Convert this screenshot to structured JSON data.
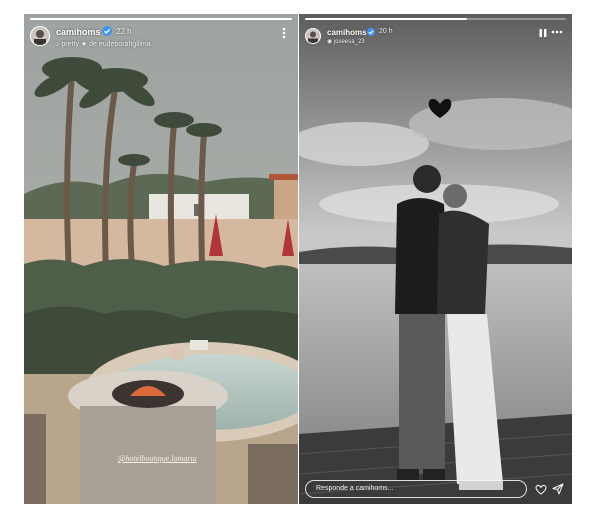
{
  "left_story": {
    "username": "camihoms",
    "time": "22 h",
    "subline": "pretty ★ de eudeborahgllima",
    "mention": "@hotelboutique.lamaria",
    "progress": 1.0,
    "icons": {
      "avatar": "avatar-image",
      "verified": "verified-badge",
      "music": "music-note-icon",
      "more": "more-icon"
    }
  },
  "right_story": {
    "username": "camihoms",
    "time": "20 h",
    "subline": "joseesa_23",
    "reply_placeholder": "Responde a camihoms...",
    "progress": 0.62,
    "icons": {
      "pause": "pause-icon",
      "more": "more-icon",
      "like": "heart-icon",
      "share": "send-icon"
    }
  },
  "colors": {
    "verified": "#3b96f3",
    "text": "#ffffff"
  }
}
